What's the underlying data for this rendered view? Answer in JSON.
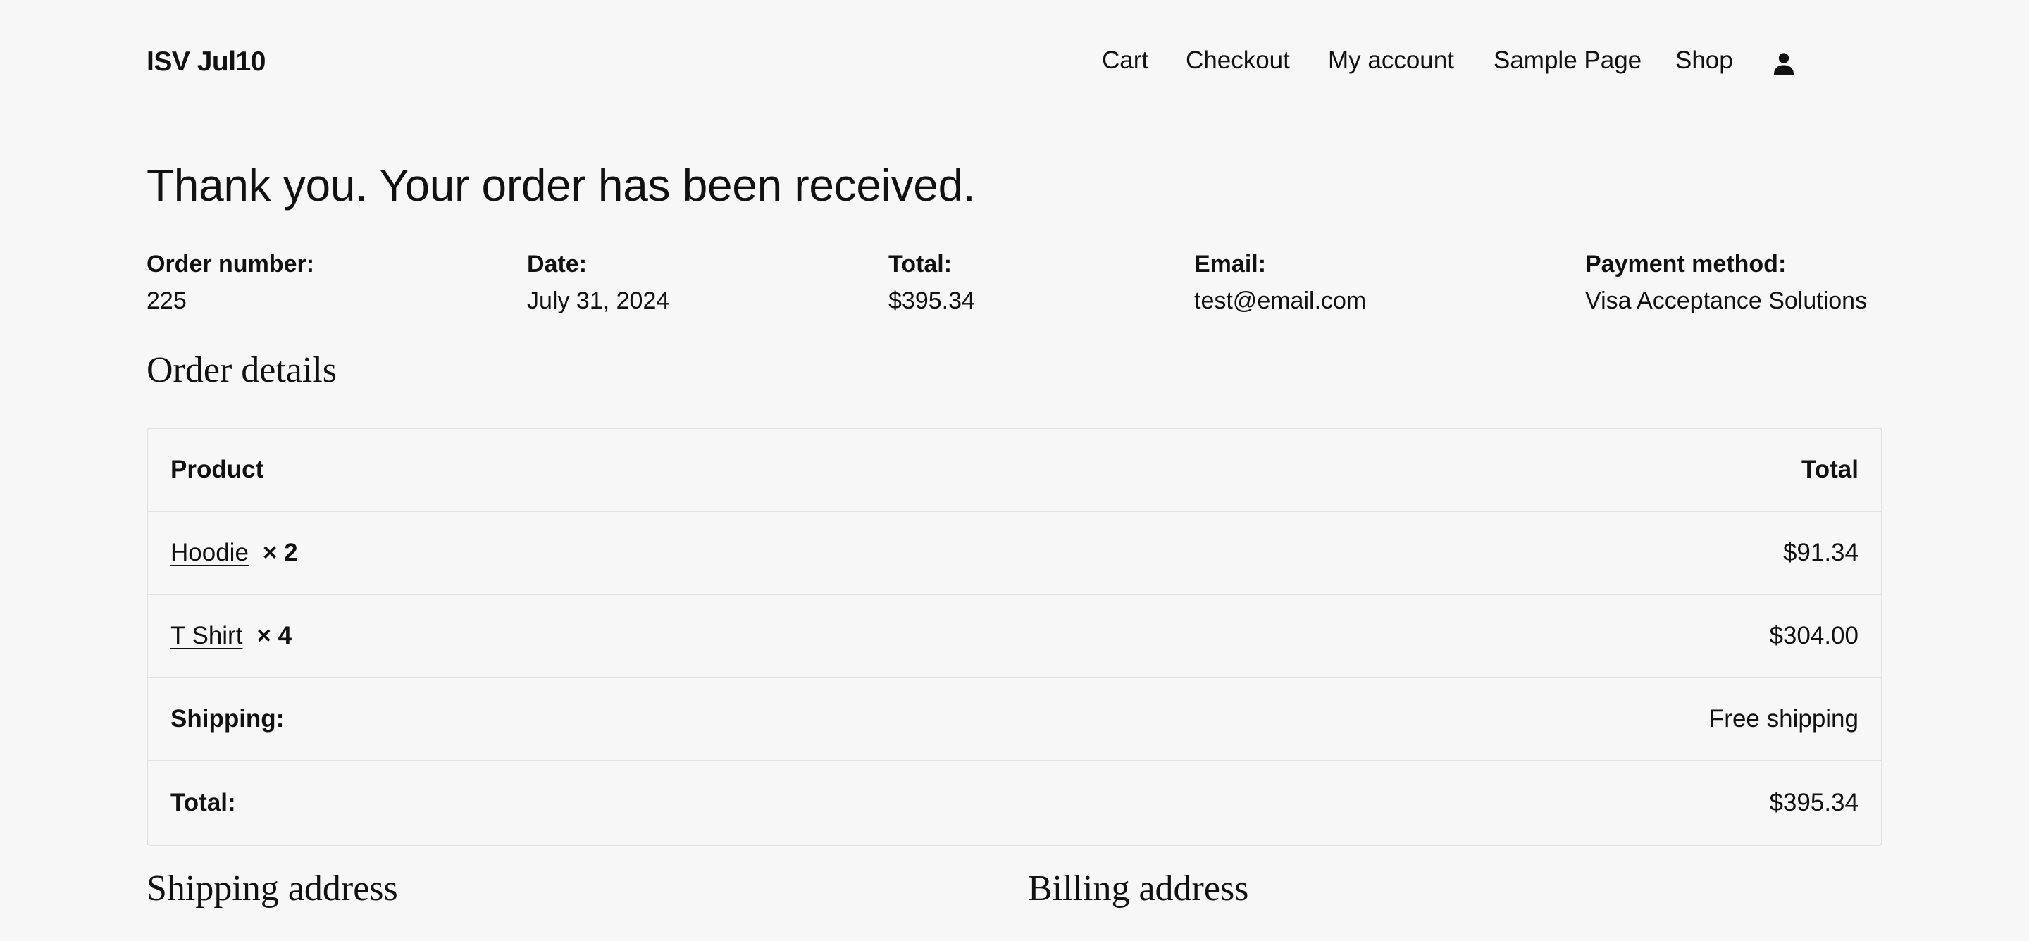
{
  "header": {
    "site_title": "ISV Jul10",
    "nav": [
      "Cart",
      "Checkout",
      "My account",
      "Sample Page",
      "Shop"
    ],
    "account_icon": "user-account-icon"
  },
  "confirmation": {
    "heading": "Thank you. Your order has been received."
  },
  "overview": {
    "order_number": {
      "label": "Order number:",
      "value": "225"
    },
    "date": {
      "label": "Date:",
      "value": "July 31, 2024"
    },
    "total": {
      "label": "Total:",
      "value": "$395.34"
    },
    "email": {
      "label": "Email:",
      "value": "test@email.com"
    },
    "payment_method": {
      "label": "Payment method:",
      "value": "Visa Acceptance Solutions"
    }
  },
  "order_details": {
    "title": "Order details",
    "columns": {
      "product": "Product",
      "total": "Total"
    },
    "items": [
      {
        "name": "Hoodie",
        "qty": "× 2",
        "total": "$91.34"
      },
      {
        "name": "T Shirt",
        "qty": "× 4",
        "total": "$304.00"
      }
    ],
    "shipping": {
      "label": "Shipping:",
      "value": "Free shipping"
    },
    "grand_total": {
      "label": "Total:",
      "value": "$395.34"
    }
  },
  "addresses": {
    "shipping_title": "Shipping address",
    "billing_title": "Billing address"
  }
}
